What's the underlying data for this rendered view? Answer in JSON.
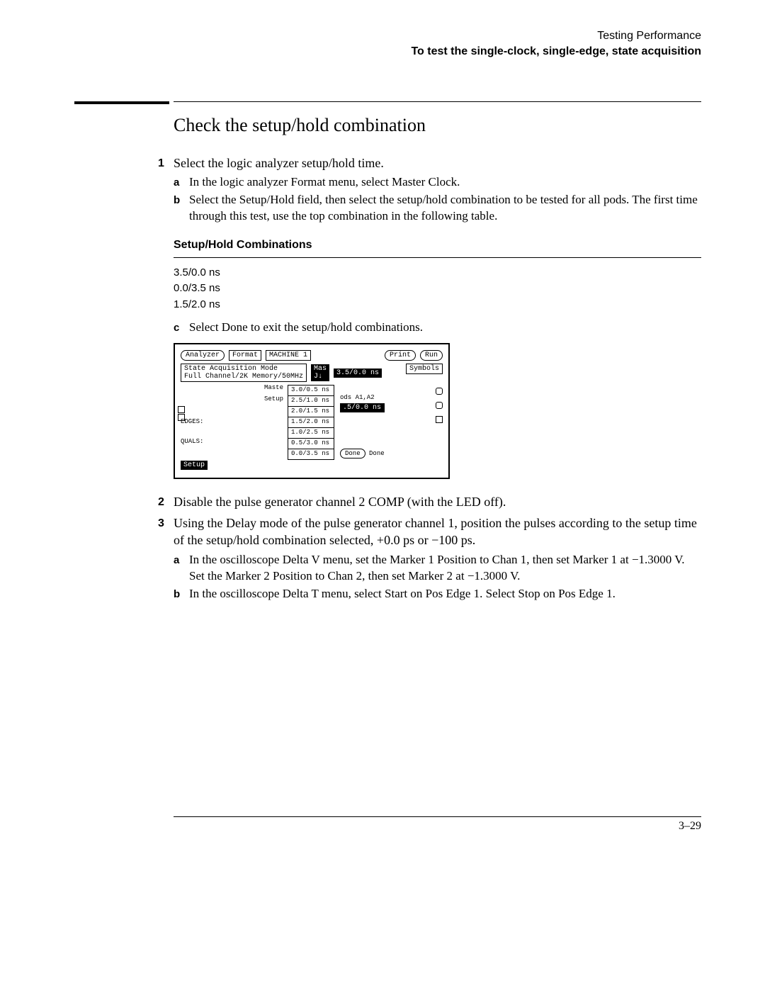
{
  "header": {
    "line1": "Testing Performance",
    "line2": "To test the single-clock, single-edge, state acquisition"
  },
  "section_title": "Check the setup/hold combination",
  "step1": {
    "num": "1",
    "text": "Select the logic analyzer setup/hold time.",
    "a_label": "a",
    "a_text": "In the logic analyzer Format menu, select Master Clock.",
    "b_label": "b",
    "b_text": "Select the Setup/Hold field, then select the setup/hold combination to be tested for all pods.  The first time through this test, use the top combination in the following table."
  },
  "table_title": "Setup/Hold Combinations",
  "combos": [
    "3.5/0.0 ns",
    "0.0/3.5 ns",
    "1.5/2.0 ns"
  ],
  "step1c": {
    "label": "c",
    "text": "Select Done to exit the setup/hold combinations."
  },
  "figure": {
    "analyzer": "Analyzer",
    "format": "Format",
    "machine": "MACHINE 1",
    "print": "Print",
    "run": "Run",
    "mode_line1": "State Acquisition Mode",
    "mode_line2": "Full Channel/2K Memory/50MHz",
    "mas": "Mas",
    "jdown": "J↓",
    "sel": "3.5/0.0 ns",
    "symbols": "Symbols",
    "maste": "Maste",
    "setup_label": "Setup",
    "menu_items": [
      "3.0/0.5 ns",
      "2.5/1.0 ns",
      "2.0/1.5 ns",
      "1.5/2.0 ns",
      "1.0/2.5 ns",
      "0.5/3.0 ns",
      "0.0/3.5 ns"
    ],
    "pods": "ods A1,A2",
    "hl": ".5/0.0 ns",
    "edges": "EDGES:",
    "quals": "QUALS:",
    "setup_black": "Setup",
    "done1": "Done",
    "done2": "Done"
  },
  "step2": {
    "num": "2",
    "text": "Disable the pulse generator channel 2 COMP (with the LED off)."
  },
  "step3": {
    "num": "3",
    "text": "Using the Delay mode of the pulse generator channel 1, position the pulses according to the setup time of the setup/hold combination selected, +0.0 ps or −100 ps.",
    "a_label": "a",
    "a_text": "In the oscilloscope Delta V menu, set the Marker 1 Position to Chan 1,  then set Marker 1 at −1.3000 V.  Set the Marker 2 Position to Chan 2, then set Marker 2 at −1.3000 V.",
    "b_label": "b",
    "b_text": "In the oscilloscope Delta T menu, select Start on Pos Edge 1.  Select Stop on Pos Edge 1."
  },
  "page_number": "3–29"
}
